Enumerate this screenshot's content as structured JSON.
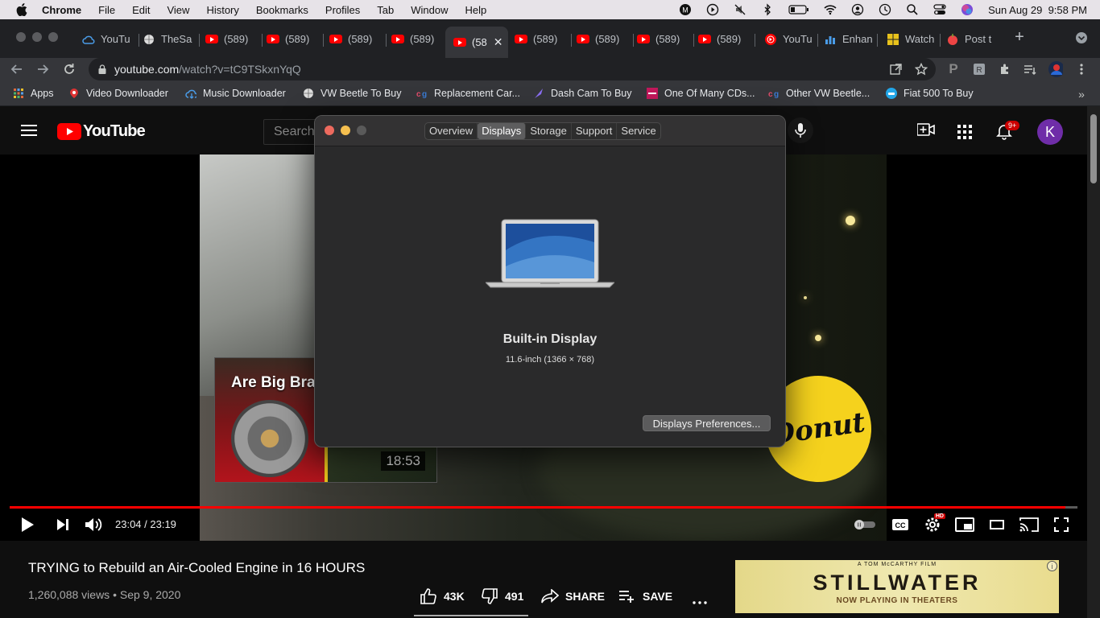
{
  "menubar": {
    "app": "Chrome",
    "items": [
      "File",
      "Edit",
      "View",
      "History",
      "Bookmarks",
      "Profiles",
      "Tab",
      "Window",
      "Help"
    ],
    "datetime": "Sun Aug 29  9:58 PM"
  },
  "tabs": [
    {
      "label": "YouTu",
      "icon": "cloud-icon"
    },
    {
      "label": "TheSa",
      "icon": "globe-icon"
    },
    {
      "label": "(589)",
      "icon": "youtube-icon"
    },
    {
      "label": "(589)",
      "icon": "youtube-icon"
    },
    {
      "label": "(589)",
      "icon": "youtube-icon"
    },
    {
      "label": "(589)",
      "icon": "youtube-icon"
    },
    {
      "label": "(58",
      "icon": "youtube-icon",
      "active": true
    },
    {
      "label": "(589)",
      "icon": "youtube-icon"
    },
    {
      "label": "(589)",
      "icon": "youtube-icon"
    },
    {
      "label": "(589)",
      "icon": "youtube-icon"
    },
    {
      "label": "(589)",
      "icon": "youtube-icon"
    },
    {
      "label": "YouTu",
      "icon": "youtube-music-icon"
    },
    {
      "label": "Enhan",
      "icon": "chart-icon"
    },
    {
      "label": "Watch",
      "icon": "grid-icon"
    },
    {
      "label": "Post t",
      "icon": "apple-icon"
    }
  ],
  "address": {
    "domain": "youtube.com",
    "path": "/watch?v=tC9TSkxnYqQ"
  },
  "bookmarks": [
    {
      "label": "Apps",
      "icon": "apps-grid-icon"
    },
    {
      "label": "Video Downloader",
      "icon": "download-icon"
    },
    {
      "label": "Music Downloader",
      "icon": "cloud-download-icon"
    },
    {
      "label": "VW Beetle To Buy",
      "icon": "globe-icon"
    },
    {
      "label": "Replacement Car...",
      "icon": "cg-icon"
    },
    {
      "label": "Dash Cam To Buy",
      "icon": "feather-icon"
    },
    {
      "label": "One Of Many CDs...",
      "icon": "store-icon"
    },
    {
      "label": "Other VW Beetle...",
      "icon": "cg-icon"
    },
    {
      "label": "Fiat 500 To Buy",
      "icon": "car-icon"
    }
  ],
  "youtube": {
    "logo": "YouTube",
    "search_placeholder": "Search",
    "notifications": "9+",
    "avatar": "K"
  },
  "player": {
    "current": "23:04",
    "duration": "23:19",
    "time_display": "23:04 / 23:19",
    "progress": 0.989,
    "endcard_title": "Are Big Bra",
    "endcard_duration": "18:53",
    "donut_logo": "Donut"
  },
  "video": {
    "title": "TRYING to Rebuild an Air-Cooled Engine in 16 HOURS",
    "meta": "1,260,088 views • Sep 9, 2020",
    "likes": "43K",
    "dislikes": "491",
    "share": "SHARE",
    "save": "SAVE"
  },
  "ad": {
    "pre": "A TOM McCARTHY FILM",
    "main": "STILLWATER",
    "sub": "NOW PLAYING IN THEATERS"
  },
  "about_mac": {
    "tabs": [
      "Overview",
      "Displays",
      "Storage",
      "Support",
      "Service"
    ],
    "selected_tab": "Displays",
    "display_name": "Built-in Display",
    "display_size": "11.6-inch (1366 × 768)",
    "prefs_button": "Displays Preferences..."
  },
  "colors": {
    "youtube_red": "#ff0000",
    "chrome_dark": "#202124",
    "dialog_bg": "#2a2a2b",
    "avatar_purple": "#6f2da8"
  }
}
